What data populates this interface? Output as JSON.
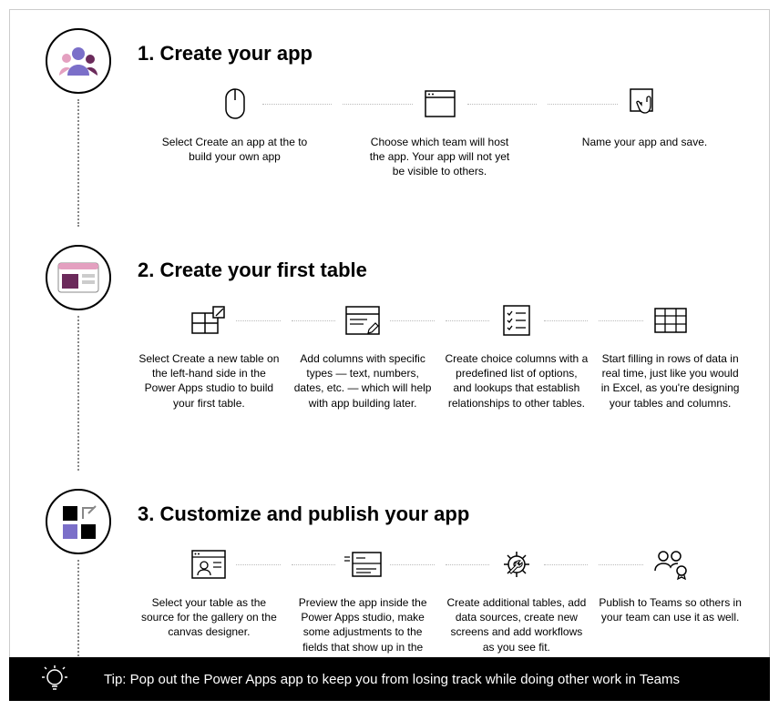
{
  "sections": [
    {
      "title": "1. Create your app",
      "circle_icon": "people-icon",
      "items": [
        {
          "icon": "mouse-icon",
          "text": "Select Create an app at the to build your own app"
        },
        {
          "icon": "browser-icon",
          "text": "Choose which team will host the app. Your app will not yet be visible to others."
        },
        {
          "icon": "tap-icon",
          "text": "Name your app and save."
        }
      ]
    },
    {
      "title": "2. Create your first table",
      "circle_icon": "table-card-icon",
      "items": [
        {
          "icon": "new-table-icon",
          "text": "Select Create a new table on the left-hand side in the Power Apps studio to build your first table."
        },
        {
          "icon": "form-edit-icon",
          "text": "Add columns with specific types — text, numbers, dates, etc. — which will help with app building later."
        },
        {
          "icon": "checklist-icon",
          "text": "Create choice columns with a predefined list of options, and lookups that establish relationships to other tables."
        },
        {
          "icon": "grid-icon",
          "text": "Start filling in rows of data in real time, just like you would in Excel, as you're designing your tables and columns."
        }
      ]
    },
    {
      "title": "3. Customize and publish your app",
      "circle_icon": "apps-icon",
      "items": [
        {
          "icon": "preview-user-icon",
          "text": "Select your table as the source for the gallery on the canvas designer."
        },
        {
          "icon": "form-lines-icon",
          "text": "Preview the app inside the Power Apps studio, make some adjustments to the fields that show up in the form and gallery."
        },
        {
          "icon": "gear-wrench-icon",
          "text": "Create additional tables, add data sources, create new screens and add workflows as you see fit."
        },
        {
          "icon": "team-badge-icon",
          "text": "Publish to Teams so others in your team can use it as well."
        }
      ]
    }
  ],
  "tip": "Tip: Pop out the Power Apps app to keep you from losing track while doing other work in Teams"
}
